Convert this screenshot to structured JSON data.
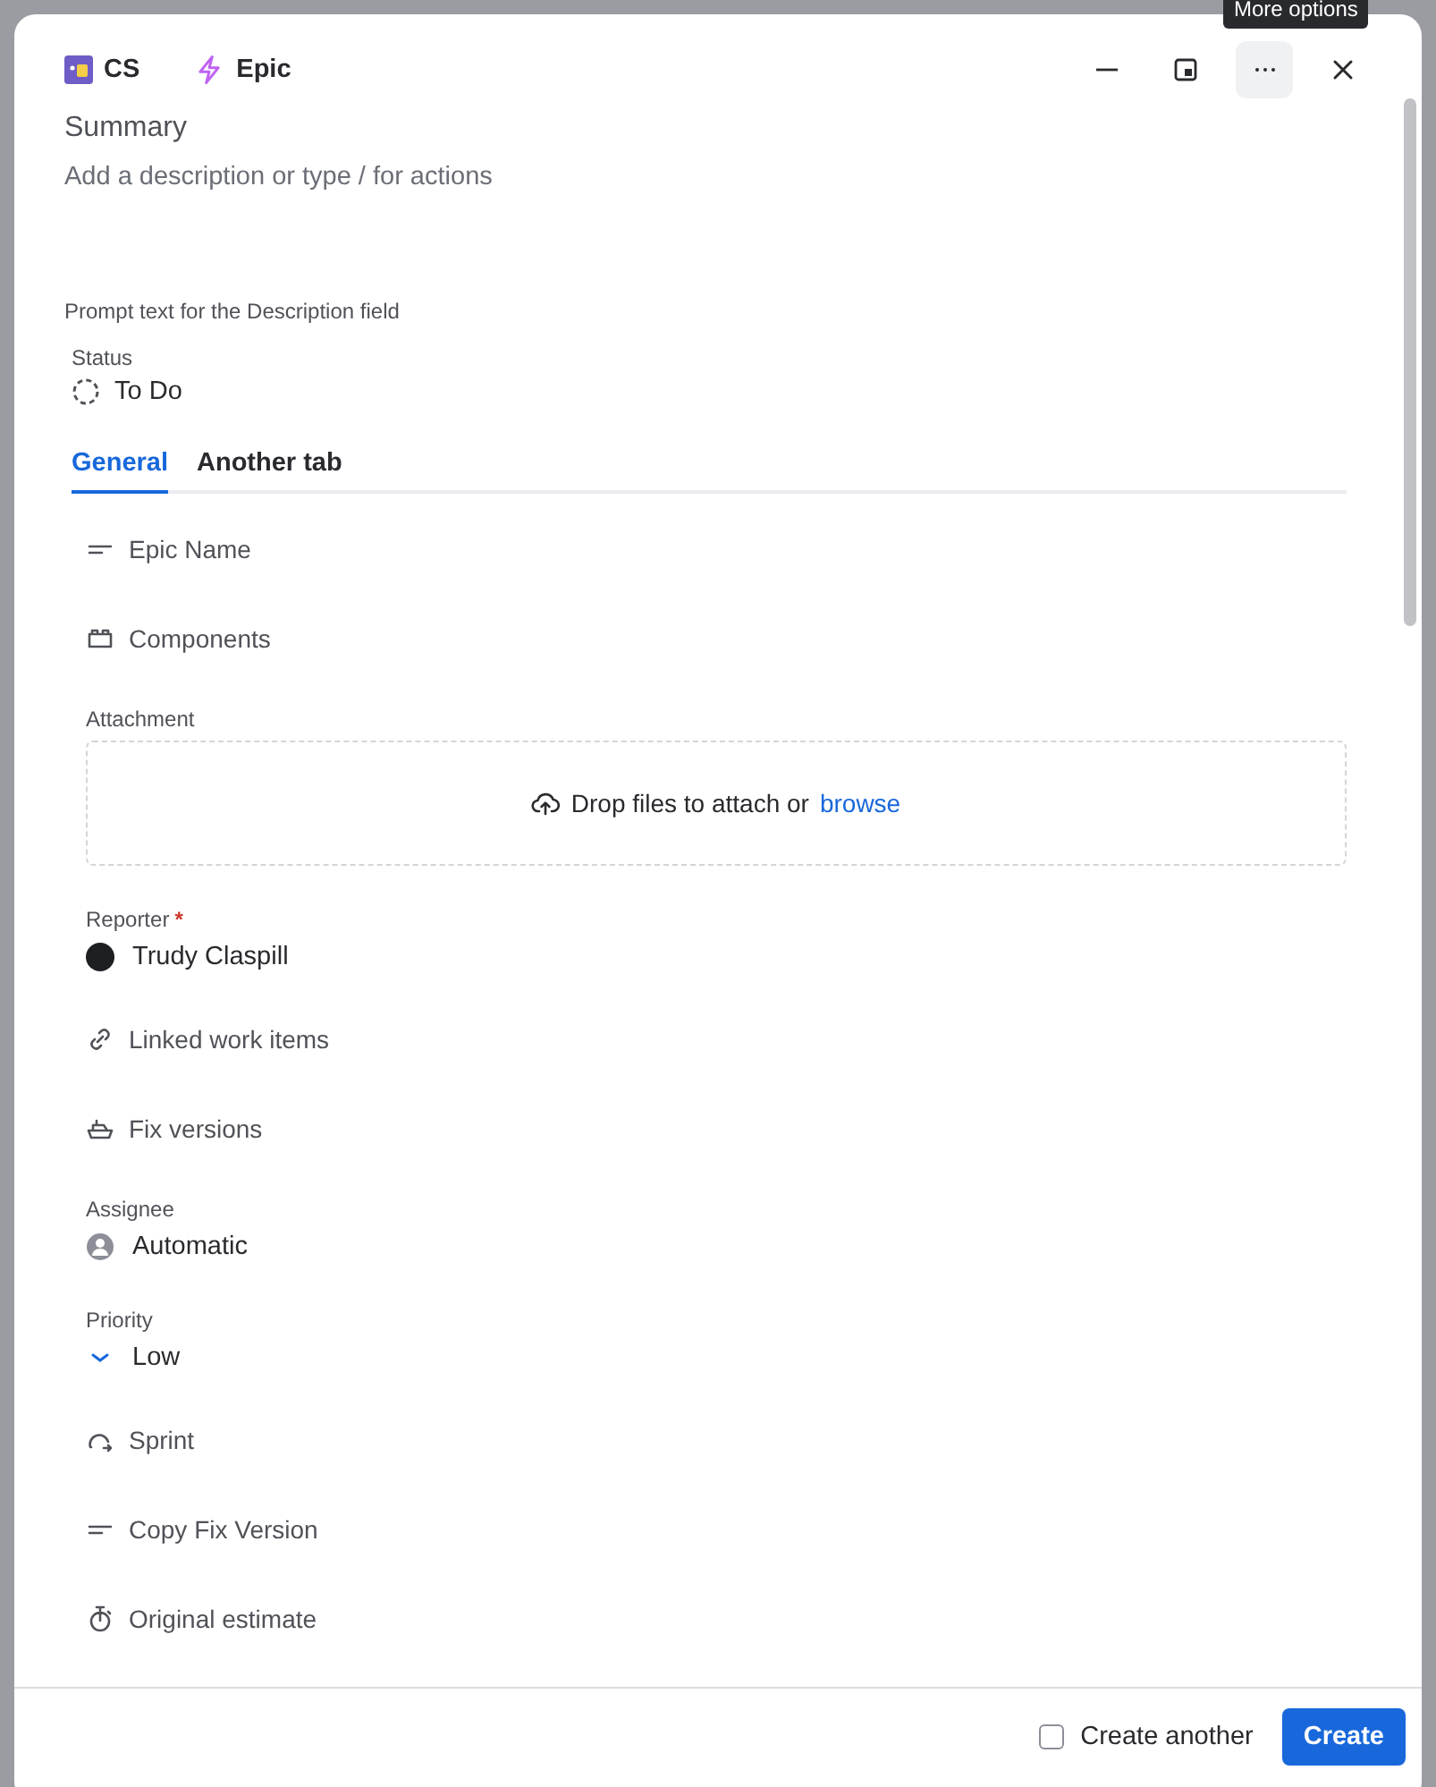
{
  "tooltip": "More options",
  "header": {
    "project": "CS",
    "issue_type": "Epic"
  },
  "summary": {
    "placeholder": "Summary"
  },
  "description": {
    "placeholder": "Add a description or type / for actions"
  },
  "description_prompt": "Prompt text for the Description field",
  "status": {
    "label": "Status",
    "value": "To Do"
  },
  "tabs": [
    {
      "label": "General",
      "selected": true
    },
    {
      "label": "Another tab",
      "selected": false
    }
  ],
  "fields": [
    {
      "kind": "text",
      "label": "Epic Name"
    },
    {
      "kind": "components",
      "label": "Components"
    },
    {
      "kind": "attachment",
      "label": "Attachment",
      "drop_text": "Drop files to attach or",
      "link": "browse"
    },
    {
      "kind": "user",
      "label": "Reporter",
      "required_mark": "*",
      "value": "Trudy Claspill"
    },
    {
      "kind": "links",
      "label": "Linked work items"
    },
    {
      "kind": "versions",
      "label": "Fix versions"
    },
    {
      "kind": "defaultuser",
      "label": "Assignee",
      "value": "Automatic"
    },
    {
      "kind": "priority",
      "label": "Priority",
      "value": "Low"
    },
    {
      "kind": "sprint",
      "label": "Sprint"
    },
    {
      "kind": "text",
      "label": "Copy Fix Version"
    },
    {
      "kind": "estimate",
      "label": "Original estimate"
    }
  ],
  "footer": {
    "create_another": {
      "label": "Create another",
      "checked": false
    },
    "button": "Create"
  }
}
